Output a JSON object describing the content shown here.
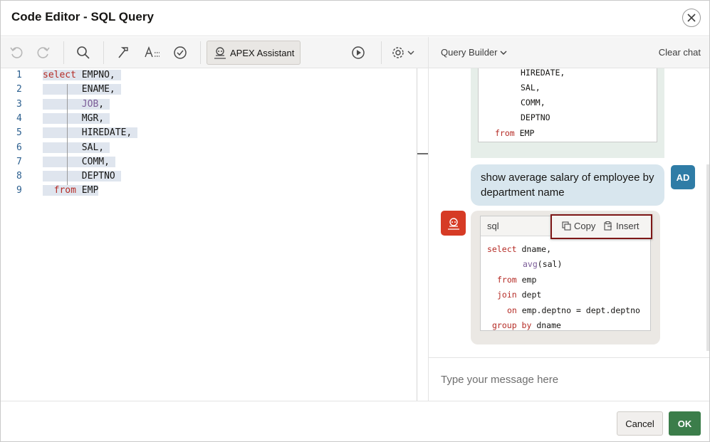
{
  "dialog": {
    "title": "Code Editor - SQL Query"
  },
  "toolbar": {
    "apex_assistant_label": "APEX Assistant",
    "icons": [
      "undo-icon",
      "redo-icon",
      "search-icon",
      "hammer-icon",
      "autocomplete-icon",
      "validate-icon",
      "run-icon",
      "settings-icon"
    ]
  },
  "chat_header": {
    "query_builder_label": "Query Builder",
    "clear_chat_label": "Clear chat"
  },
  "editor": {
    "lines": [
      {
        "num": "1",
        "kw": "select",
        "text": " EMPNO,"
      },
      {
        "num": "2",
        "indent": "       ",
        "text": "ENAME,"
      },
      {
        "num": "3",
        "indent": "       ",
        "fn": "JOB",
        "text": ","
      },
      {
        "num": "4",
        "indent": "       ",
        "text": "MGR,"
      },
      {
        "num": "5",
        "indent": "       ",
        "text": "HIREDATE,"
      },
      {
        "num": "6",
        "indent": "       ",
        "text": "SAL,"
      },
      {
        "num": "7",
        "indent": "       ",
        "text": "COMM,"
      },
      {
        "num": "8",
        "indent": "       ",
        "text": "DEPTNO"
      },
      {
        "num": "9",
        "indent": "  ",
        "kw": "from",
        "text": " EMP"
      }
    ]
  },
  "chat": {
    "previous_code_lines": [
      "HIREDATE,",
      "SAL,",
      "COMM,",
      "DEPTNO"
    ],
    "previous_from_kw": "from",
    "previous_from_text": " EMP",
    "user_message": "show average salary of employee by department name",
    "user_avatar": "AD",
    "bot_code": {
      "language": "sql",
      "copy_label": "Copy",
      "insert_label": "Insert",
      "lines": [
        {
          "kw": "select",
          "text": " dname,"
        },
        {
          "fn": "avg",
          "text": "(sal)"
        },
        {
          "kw": "from",
          "text": " emp"
        },
        {
          "kw": "join",
          "text": " dept"
        },
        {
          "kw": "on",
          "text": " emp.deptno = dept.deptno"
        },
        {
          "kw": "group by",
          "text": " dname"
        }
      ]
    }
  },
  "message_input": {
    "placeholder": "Type your message here"
  },
  "footer": {
    "cancel_label": "Cancel",
    "ok_label": "OK"
  }
}
